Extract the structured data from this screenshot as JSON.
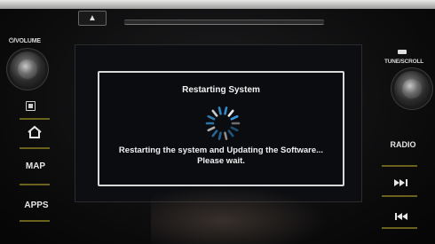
{
  "controls": {
    "eject_glyph": "▲",
    "left_knob_label": "⏻/VOLUME",
    "right_knob_label": "TUNE/SCROLL",
    "left_buttons": [
      "MAP",
      "APPS"
    ],
    "right_buttons": [
      "RADIO"
    ]
  },
  "dialog": {
    "title": "Restarting System",
    "message_line1": "Restarting the system and Updating the Software...",
    "message_line2": "Please wait."
  },
  "colors": {
    "spinner": "#3aa0e8",
    "separator": "#7a7220"
  }
}
